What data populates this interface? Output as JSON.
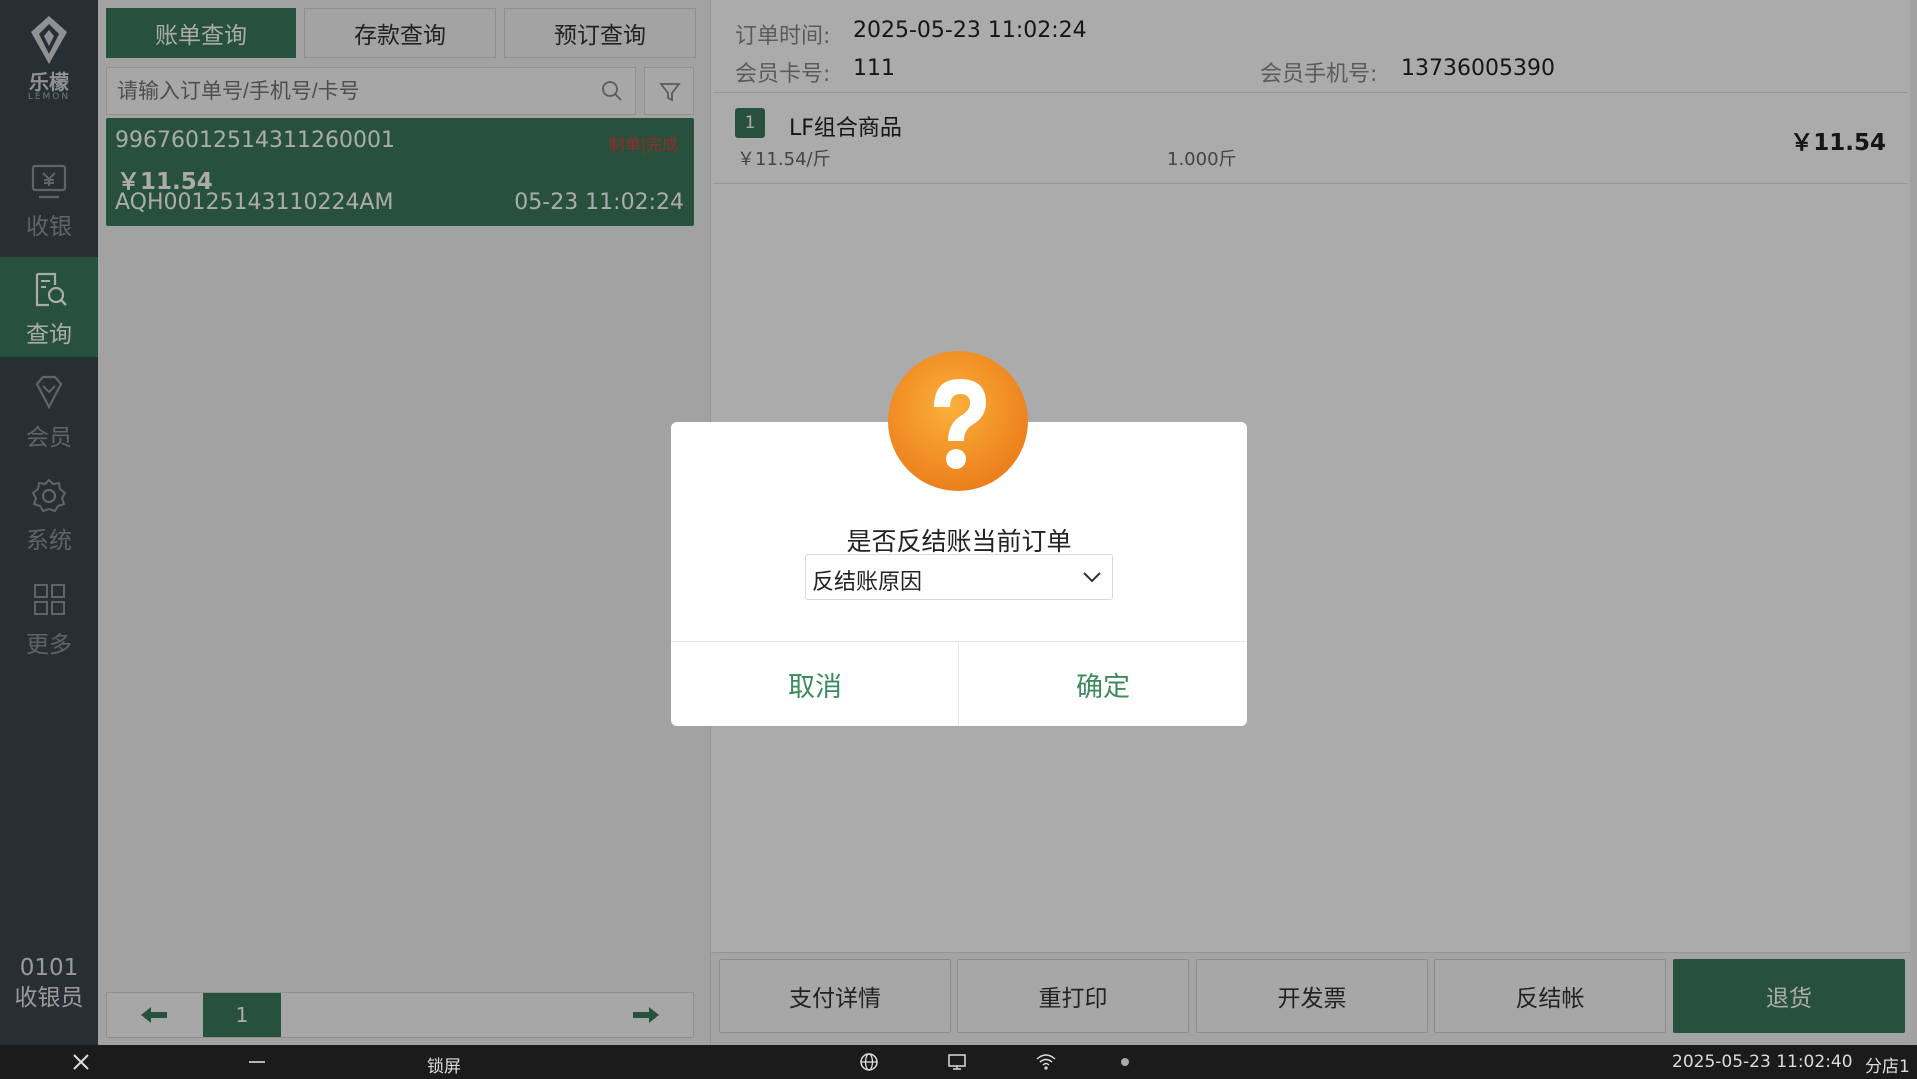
{
  "brand": {
    "name": "乐檬",
    "sub": "LEMON"
  },
  "sidebar": {
    "items": [
      {
        "label": "收银",
        "icon": "cashier-icon"
      },
      {
        "label": "查询",
        "icon": "query-icon"
      },
      {
        "label": "会员",
        "icon": "member-icon"
      },
      {
        "label": "系统",
        "icon": "gear-icon"
      },
      {
        "label": "更多",
        "icon": "grid-icon"
      }
    ],
    "operator_id": "0101",
    "operator_role": "收银员"
  },
  "tabs": [
    {
      "label": "账单查询"
    },
    {
      "label": "存款查询"
    },
    {
      "label": "预订查询"
    }
  ],
  "search": {
    "placeholder": "请输入订单号/手机号/卡号"
  },
  "orders": [
    {
      "order_no": "99676012514311260001",
      "status": "制单|完成",
      "amount": "￥11.54",
      "code": "AQH00125143110224AM",
      "time": "05-23 11:02:24"
    }
  ],
  "pagination": {
    "page": "1"
  },
  "detail": {
    "order_time_label": "订单时间:",
    "order_time": "2025-05-23 11:02:24",
    "card_label": "会员卡号:",
    "card_no": "111",
    "phone_label": "会员手机号:",
    "phone": "13736005390",
    "items": [
      {
        "index": "1",
        "name": "LF组合商品",
        "unit_price": "￥11.54/斤",
        "qty": "1.000斤",
        "subtotal": "￥11.54"
      }
    ]
  },
  "actions": [
    {
      "label": "支付详情"
    },
    {
      "label": "重打印"
    },
    {
      "label": "开发票"
    },
    {
      "label": "反结帐"
    },
    {
      "label": "退货"
    }
  ],
  "dialog": {
    "question": "是否反结账当前订单",
    "reason_placeholder": "反结账原因",
    "cancel": "取消",
    "confirm": "确定"
  },
  "taskbar": {
    "lock": "锁屏",
    "datetime": "2025-05-23 11:02:40",
    "store": "分店1"
  },
  "colors": {
    "primary": "#3d7a5c",
    "sidebar": "#3b474f",
    "accent": "#f0922a",
    "alert": "#e0403a"
  }
}
